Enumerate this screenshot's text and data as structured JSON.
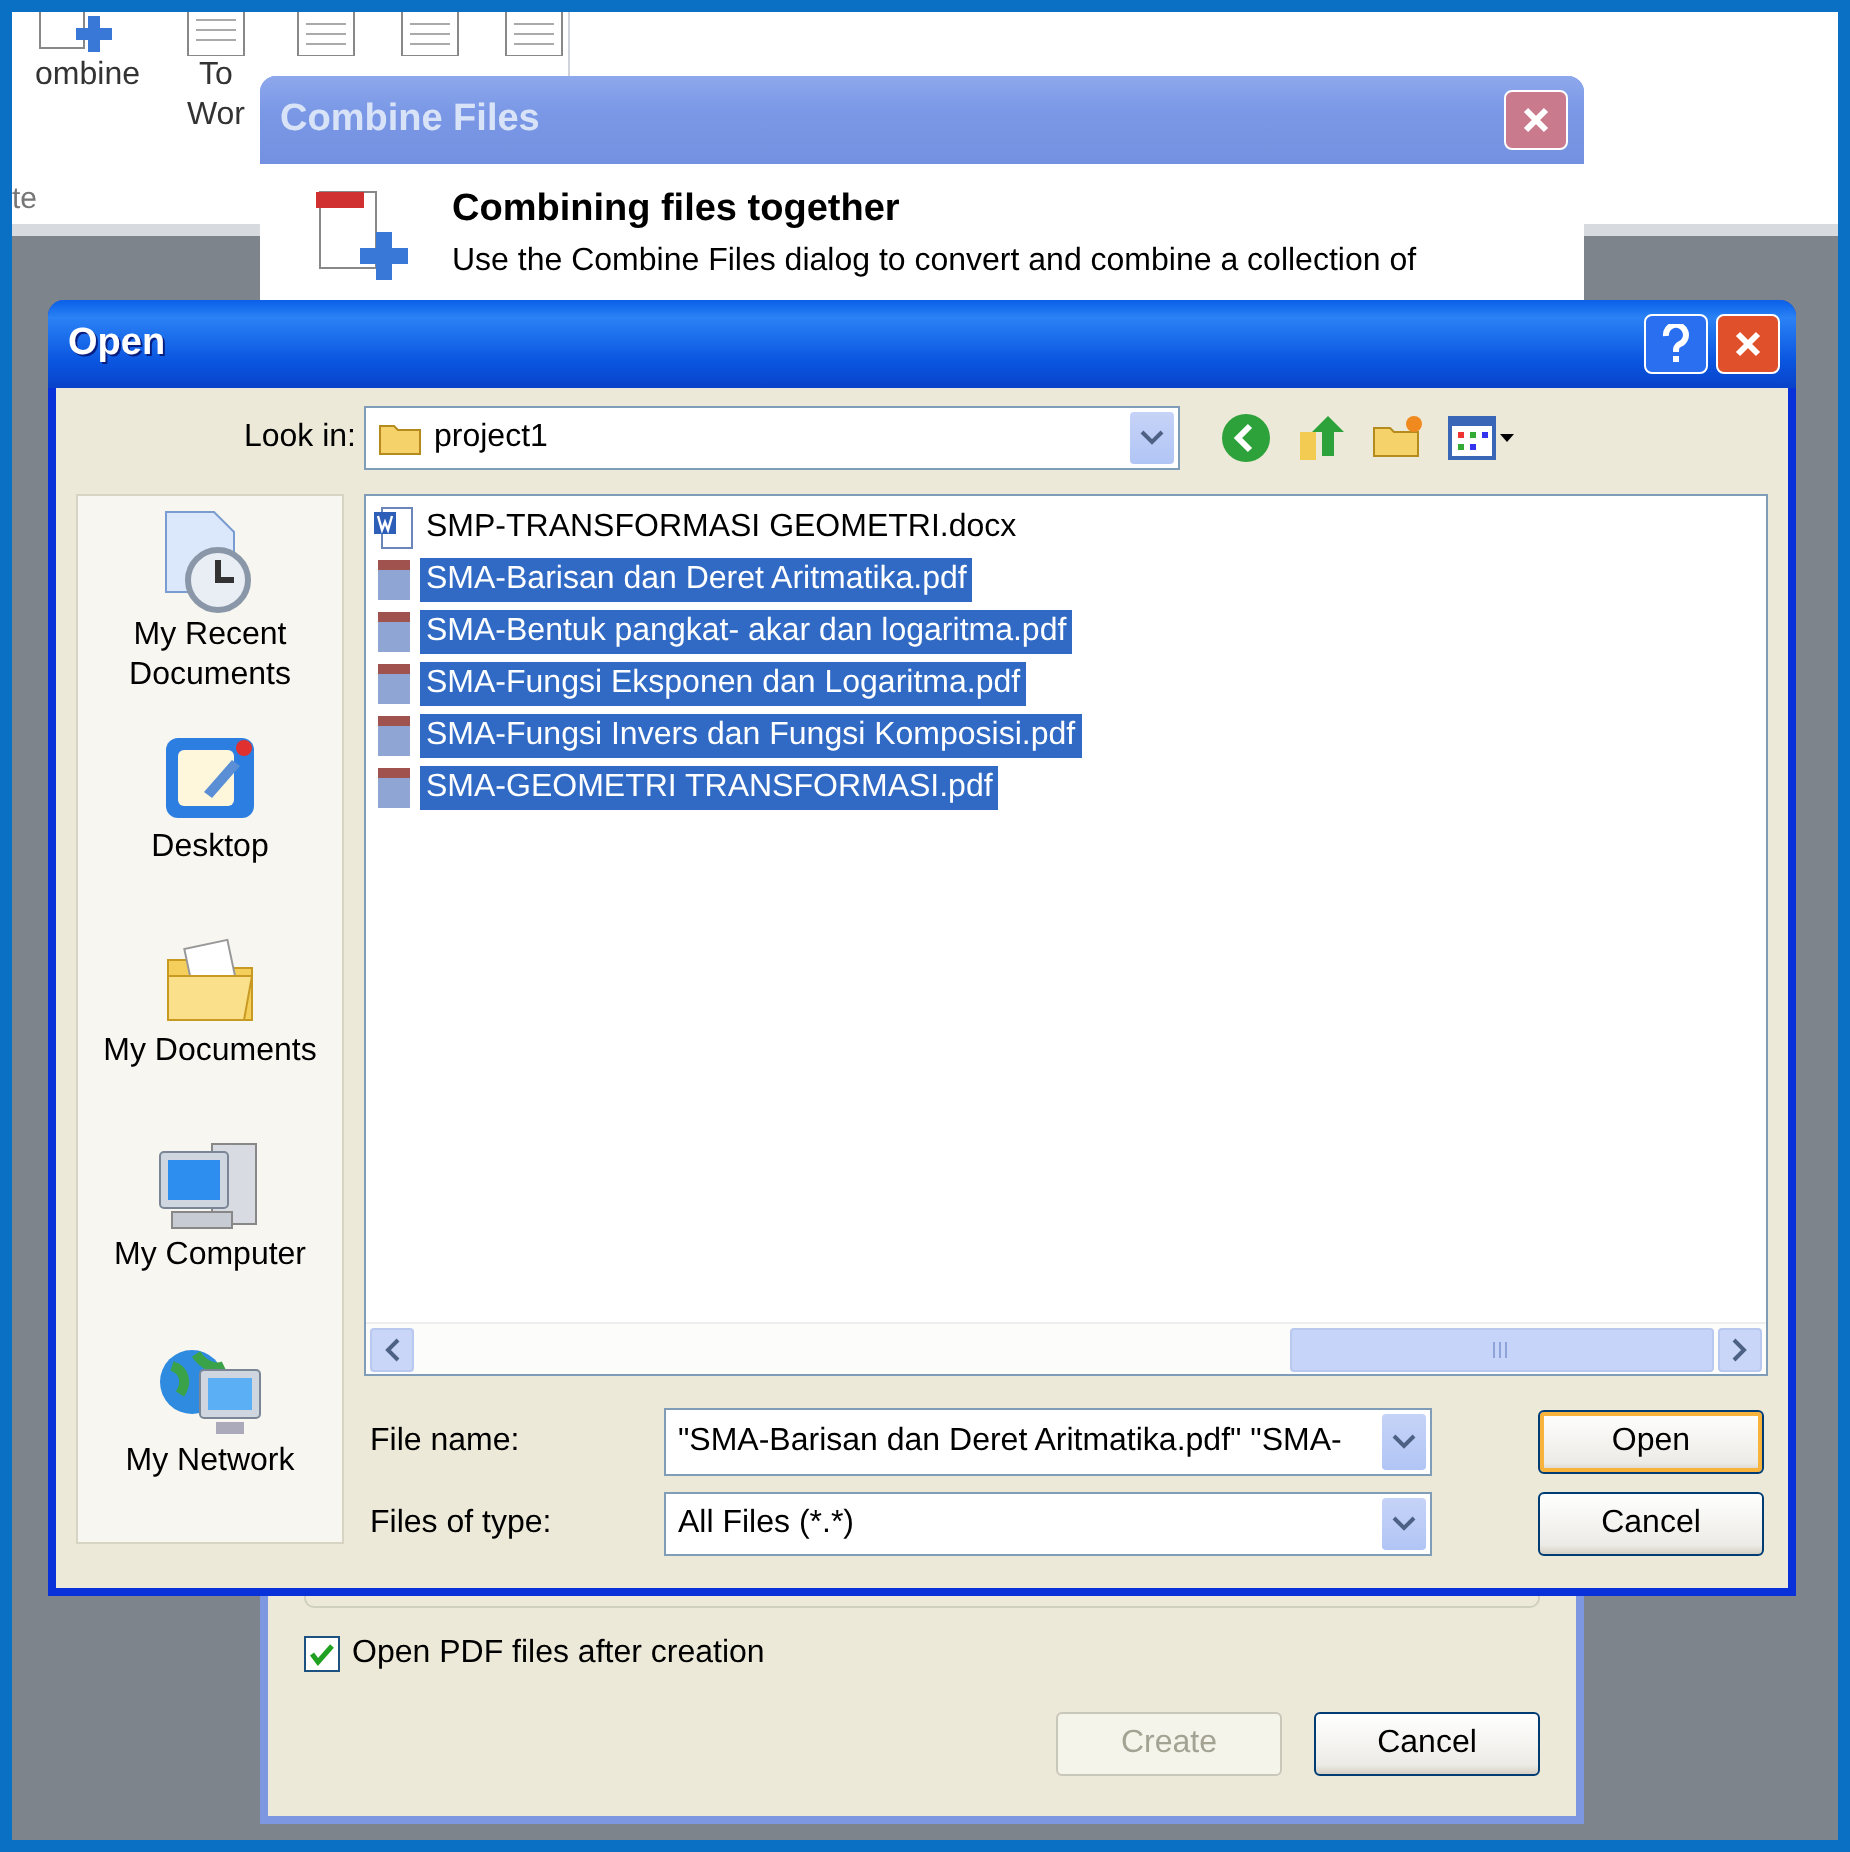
{
  "ribbon": {
    "buttons": [
      {
        "label": "ombine",
        "kind": "combine"
      },
      {
        "label": "To Wor",
        "kind": "word"
      }
    ],
    "group_label": "te"
  },
  "combine_dialog": {
    "title": "Combine Files",
    "active": false,
    "heading": "Combining files together",
    "description": "Use the Combine Files dialog to convert and combine a collection of",
    "open_pdf_after": {
      "label": "Open PDF files after creation",
      "checked": true
    },
    "buttons": [
      {
        "label": "Create",
        "disabled": true
      },
      {
        "label": "Cancel",
        "disabled": false
      }
    ]
  },
  "open_dialog": {
    "title": "Open",
    "active": true,
    "look_in": {
      "label": "Look in:",
      "value": "project1"
    },
    "places": [
      {
        "label": "My Recent Documents",
        "kind": "recent"
      },
      {
        "label": "Desktop",
        "kind": "desktop"
      },
      {
        "label": "My Documents",
        "kind": "documents"
      },
      {
        "label": "My Computer",
        "kind": "computer"
      },
      {
        "label": "My Network",
        "kind": "network"
      }
    ],
    "files": [
      {
        "name": "SMP-TRANSFORMASI GEOMETRI.docx",
        "kind": "word",
        "selected": false
      },
      {
        "name": "SMA-Barisan dan Deret Aritmatika.pdf",
        "kind": "pdf",
        "selected": true
      },
      {
        "name": "SMA-Bentuk pangkat- akar dan logaritma.pdf",
        "kind": "pdf",
        "selected": true
      },
      {
        "name": "SMA-Fungsi Eksponen dan Logaritma.pdf",
        "kind": "pdf",
        "selected": true
      },
      {
        "name": "SMA-Fungsi Invers dan Fungsi Komposisi.pdf",
        "kind": "pdf",
        "selected": true
      },
      {
        "name": "SMA-GEOMETRI TRANSFORMASI.pdf",
        "kind": "pdf",
        "selected": true
      }
    ],
    "file_name": {
      "label": "File name:",
      "value": "\"SMA-Barisan dan Deret Aritmatika.pdf\" \"SMA-"
    },
    "file_type": {
      "label": "Files of type:",
      "value": "All Files (*.*)"
    },
    "buttons": [
      {
        "label": "Open",
        "default": true
      },
      {
        "label": "Cancel",
        "default": false
      }
    ]
  }
}
